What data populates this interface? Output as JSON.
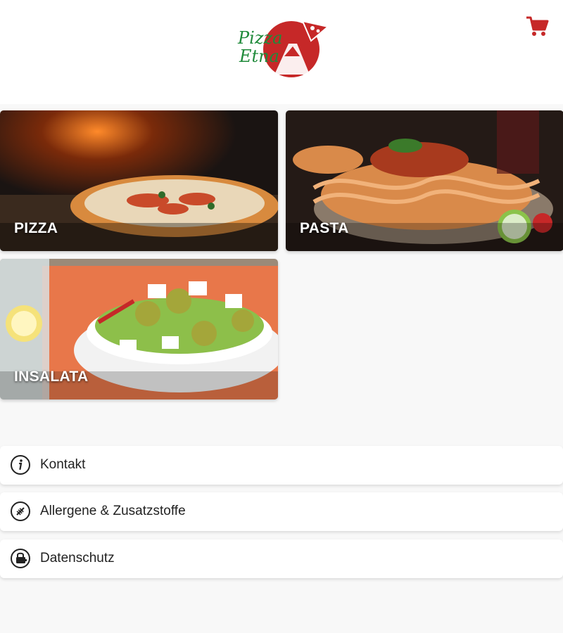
{
  "brand": {
    "name_line1": "Pizza",
    "name_line2": "Etna",
    "colors": {
      "green": "#1f8a3a",
      "red": "#c62828"
    }
  },
  "header": {
    "cart_icon": "cart-icon"
  },
  "categories": [
    {
      "label": "PIZZA"
    },
    {
      "label": "PASTA"
    },
    {
      "label": "INSALATA"
    }
  ],
  "menu": [
    {
      "label": "Kontakt",
      "icon": "info-icon"
    },
    {
      "label": "Allergene & Zusatzstoffe",
      "icon": "wheat-icon"
    },
    {
      "label": "Datenschutz",
      "icon": "privacy-icon"
    }
  ]
}
